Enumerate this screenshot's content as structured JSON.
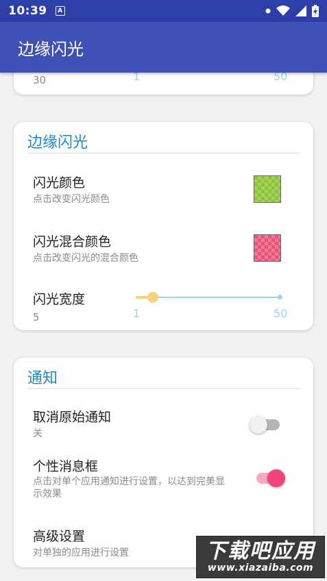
{
  "status_bar": {
    "time": "10:39",
    "notification_letter": "A"
  },
  "app_bar": {
    "title": "边缘闪光"
  },
  "top_card_partial": {
    "value": "30",
    "slider_min": "1",
    "slider_max": "50"
  },
  "flash_card": {
    "title": "边缘闪光",
    "color": {
      "title": "闪光颜色",
      "summary": "点击改变闪光颜色",
      "swatch_color": "#8ac43f"
    },
    "mix_color": {
      "title": "闪光混合颜色",
      "summary": "点击改变闪光的混合颜色",
      "swatch_color": "#e5557a"
    },
    "width": {
      "title": "闪光宽度",
      "value": "5",
      "slider_min": "1",
      "slider_max": "50",
      "level": 5
    }
  },
  "notify_card": {
    "title": "通知",
    "cancel_original": {
      "title": "取消原始通知",
      "summary": "关",
      "enabled": false
    },
    "custom_box": {
      "title": "个性消息框",
      "summary": "点击对单个应用通知进行设置，以达到完美显示效果",
      "enabled": true
    },
    "advanced": {
      "title": "高级设置",
      "summary": "对单独的应用进行设置"
    }
  },
  "watermark": {
    "main": "下载吧应用",
    "url": "www.xiazaiba.com"
  },
  "colors": {
    "status_bar": "#2e3ea8",
    "app_bar": "#3f51b5",
    "accent": "#1e88c8",
    "toggle_on": "#f0457a"
  }
}
